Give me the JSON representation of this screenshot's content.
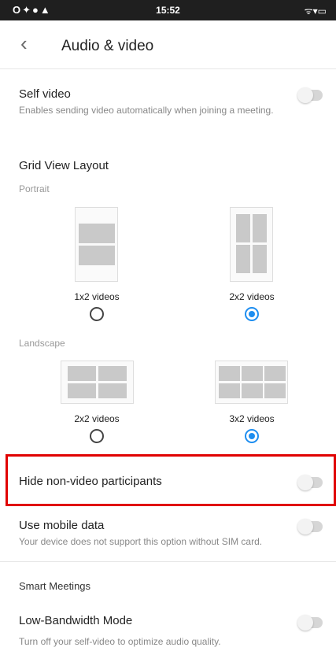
{
  "status_bar": {
    "left_icons": "O✦●▲",
    "time": "15:52",
    "right_icons": "ᯤ▾▭"
  },
  "header": {
    "back_icon": "‹",
    "title": "Audio & video"
  },
  "self_video": {
    "title": "Self video",
    "subtitle": "Enables sending video automatically when joining a meeting.",
    "enabled": false
  },
  "grid_view": {
    "heading": "Grid View Layout",
    "portrait_label": "Portrait",
    "landscape_label": "Landscape",
    "portrait_options": [
      {
        "label": "1x2 videos",
        "selected": false
      },
      {
        "label": "2x2 videos",
        "selected": true
      }
    ],
    "landscape_options": [
      {
        "label": "2x2 videos",
        "selected": false
      },
      {
        "label": "3x2 videos",
        "selected": true
      }
    ]
  },
  "hide_non_video": {
    "title": "Hide non-video participants",
    "enabled": false
  },
  "mobile_data": {
    "title": "Use mobile data",
    "subtitle": "Your device does not support this option without SIM card.",
    "enabled": false
  },
  "smart_meetings": {
    "heading": "Smart Meetings"
  },
  "low_bandwidth": {
    "title": "Low-Bandwidth Mode",
    "subtitle": "Turn off your self-video to optimize audio quality.",
    "enabled": false
  },
  "colors": {
    "accent": "#1e8ef0",
    "highlight": "#e00000",
    "status_bar": "#1f1f1f"
  }
}
